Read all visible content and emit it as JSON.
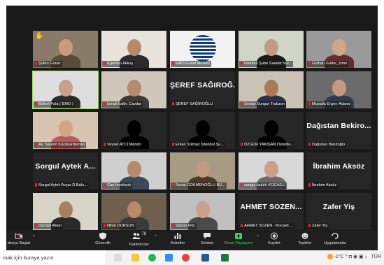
{
  "meeting": {
    "tiles": [
      {
        "label": "Şükrü Güner",
        "name_text": "",
        "hand": true
      },
      {
        "label": "Egemen Akkuş",
        "name_text": ""
      },
      {
        "label": "EMO Genel Merkez",
        "name_text": ""
      },
      {
        "label": "İstanbul Şube Saadet Nur...",
        "name_text": ""
      },
      {
        "label": "Gülhan Gürler_İzmir",
        "name_text": ""
      },
      {
        "label": "Bülent Pala ( EMO )",
        "name_text": "",
        "active": true
      },
      {
        "label": "İsmail hakkı Cavdar",
        "name_text": ""
      },
      {
        "label": "ŞEREF SAĞIROĞLU",
        "name_text": "ŞEREF SAĞIROĞ..."
      },
      {
        "label": "Serdar Sungur Trabzon",
        "name_text": ""
      },
      {
        "label": "Mustafa Ergen-Adana",
        "name_text": ""
      },
      {
        "label": "Av. Sanem Küçükarduman",
        "name_text": ""
      },
      {
        "label": "Veysel ATCI Mersin",
        "name_text": ""
      },
      {
        "label": "Erkan Solmaz İstanbul Şu...",
        "name_text": ""
      },
      {
        "label": "ÖZGÜR YAKIŞAN Denetle...",
        "name_text": ""
      },
      {
        "label": "Dağıstan Bekiroğlu",
        "name_text": "Dağıstan Bekiro..."
      },
      {
        "label": "Sorgul Aytek Avşar D.Bakı...",
        "name_text": "Sorgul Aytek A..."
      },
      {
        "label": "Can İncebıyık",
        "name_text": ""
      },
      {
        "label": "Sedat GÖKMENOĞLU BU...",
        "name_text": ""
      },
      {
        "label": "cengiz öztürk  KOCAELİ",
        "name_text": ""
      },
      {
        "label": "İbrahim Aksöz",
        "name_text": "İbrahim Aksöz"
      },
      {
        "label": "Osman Alkan",
        "name_text": ""
      },
      {
        "label": "Nihat DURSUN",
        "name_text": ""
      },
      {
        "label": "Şaban Filiz",
        "name_text": ""
      },
      {
        "label": "AHMET SOZEN - Kocaeli ...",
        "name_text": "AHMET SOZEN..."
      },
      {
        "label": "Zafer Yiş",
        "name_text": "Zafer Yiş"
      }
    ]
  },
  "toolbar": {
    "video": "deoyu Başlat",
    "security": "Güvenlik",
    "participants": "Katılımcılar",
    "participants_count": "78",
    "polls": "Anketler",
    "chat": "Sohbet",
    "share": "Ekran Paylaşımı",
    "record": "Kaydet",
    "reactions": "Tepkiler",
    "apps": "Uygulamalar"
  },
  "taskbar": {
    "search_placeholder": "mak için buraya yazın",
    "weather": "-1°C"
  },
  "colors": {
    "meeting_bg": "#1a1a1a",
    "tile_bg": "#262626",
    "active_speaker": "#9bdc52",
    "share_green": "#3bd16f",
    "muted_red": "#e02828"
  }
}
